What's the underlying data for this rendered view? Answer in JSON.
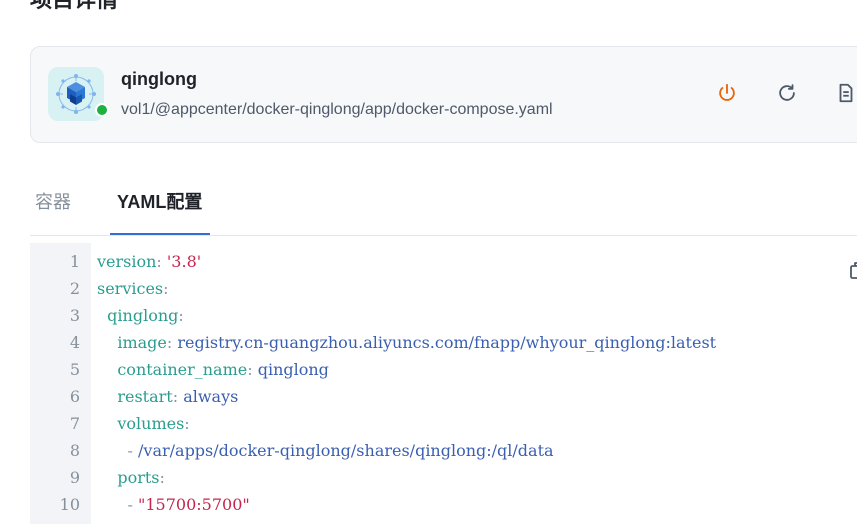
{
  "page": {
    "title": "项目详情"
  },
  "app": {
    "name": "qinglong",
    "path": "vol1/@appcenter/docker-qinglong/app/docker-compose.yaml",
    "status_color": "#1db240",
    "icon": "cube-app-icon",
    "actions": [
      {
        "name": "power-icon",
        "color": "#e8650a"
      },
      {
        "name": "restart-icon",
        "color": "#4e5969"
      },
      {
        "name": "document-icon",
        "color": "#4e5969"
      }
    ]
  },
  "tabs": {
    "items": [
      "容器",
      "YAML配置"
    ],
    "active": "YAML配置",
    "accent": "#2f6fd6"
  },
  "yaml": {
    "line_numbers": [
      "1",
      "2",
      "3",
      "4",
      "5",
      "6",
      "7",
      "8",
      "9",
      "10"
    ],
    "lines": [
      {
        "indent": "",
        "key": "version",
        "sep": ": ",
        "value": "'3.8'",
        "vtype": "s"
      },
      {
        "indent": "",
        "key": "services",
        "sep": ":",
        "value": "",
        "vtype": "v"
      },
      {
        "indent": "  ",
        "key": "qinglong",
        "sep": ":",
        "value": "",
        "vtype": "v"
      },
      {
        "indent": "    ",
        "key": "image",
        "sep": ": ",
        "value": "registry.cn-guangzhou.aliyuncs.com/fnapp/whyour_qinglong:latest",
        "vtype": "v"
      },
      {
        "indent": "    ",
        "key": "container_name",
        "sep": ": ",
        "value": "qinglong",
        "vtype": "v"
      },
      {
        "indent": "    ",
        "key": "restart",
        "sep": ": ",
        "value": "always",
        "vtype": "v"
      },
      {
        "indent": "    ",
        "key": "volumes",
        "sep": ":",
        "value": "",
        "vtype": "v"
      },
      {
        "indent": "      ",
        "key": "",
        "sep": "- ",
        "value": "/var/apps/docker-qinglong/shares/qinglong:/ql/data",
        "vtype": "v"
      },
      {
        "indent": "    ",
        "key": "ports",
        "sep": ":",
        "value": "",
        "vtype": "v"
      },
      {
        "indent": "      ",
        "key": "",
        "sep": "- ",
        "value": "\"15700:5700\"",
        "vtype": "s"
      }
    ]
  }
}
